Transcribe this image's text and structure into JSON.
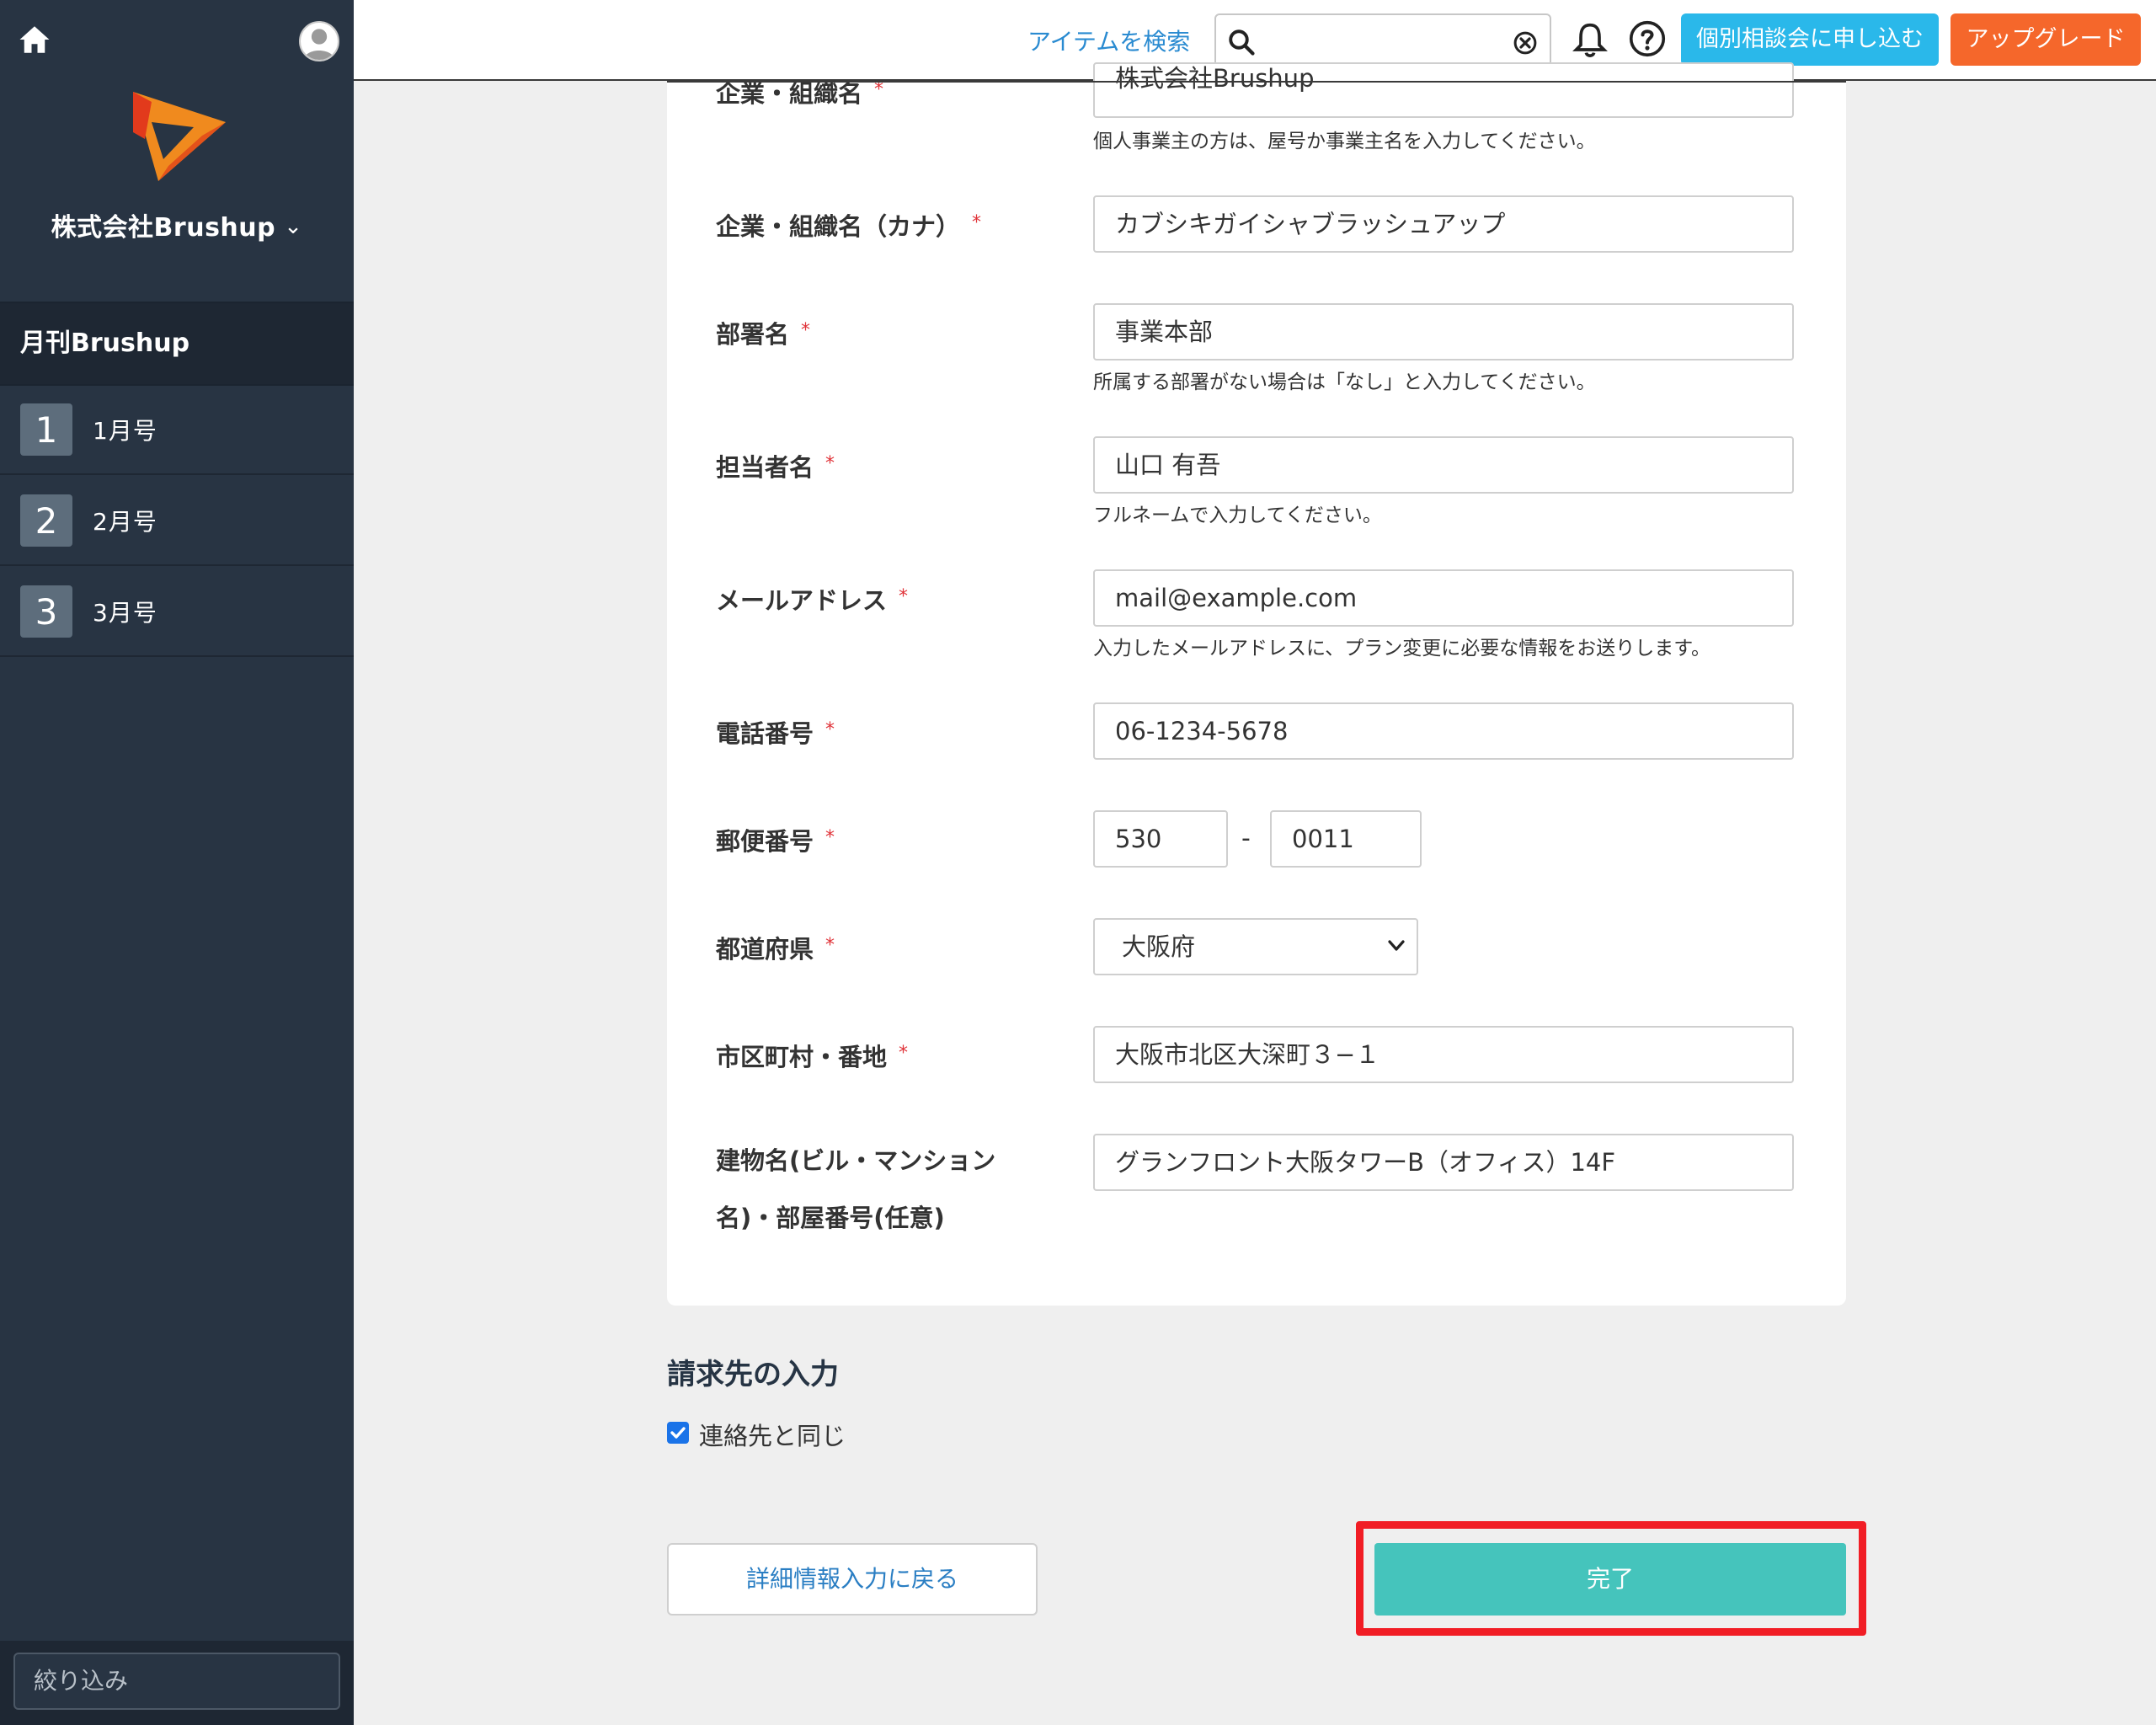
{
  "sidebar": {
    "org_name": "株式会社Brushup",
    "project_title": "月刊Brushup",
    "issues": [
      {
        "num": "1",
        "label": "1月号"
      },
      {
        "num": "2",
        "label": "2月号"
      },
      {
        "num": "3",
        "label": "3月号"
      }
    ],
    "filter_placeholder": "絞り込み"
  },
  "topbar": {
    "search_link": "アイテムを検索",
    "search_value": "",
    "consult_button": "個別相談会に申し込む",
    "upgrade_button": "アップグレード"
  },
  "form": {
    "company": {
      "label": "企業・組織名",
      "value": "株式会社Brushup",
      "help": "個人事業主の方は、屋号か事業主名を入力してください。"
    },
    "company_kana": {
      "label": "企業・組織名（カナ）",
      "value": "カブシキガイシャブラッシュアップ"
    },
    "department": {
      "label": "部署名",
      "value": "事業本部",
      "help": "所属する部署がない場合は「なし」と入力してください。"
    },
    "person": {
      "label": "担当者名",
      "value": "山口 有吾",
      "help": "フルネームで入力してください。"
    },
    "email": {
      "label": "メールアドレス",
      "value": "mail@example.com",
      "help": "入力したメールアドレスに、プラン変更に必要な情報をお送りします。"
    },
    "phone": {
      "label": "電話番号",
      "value": "06-1234-5678"
    },
    "zip": {
      "label": "郵便番号",
      "value1": "530",
      "value2": "0011",
      "dash": "-"
    },
    "prefecture": {
      "label": "都道府県",
      "value": "大阪府"
    },
    "city": {
      "label": "市区町村・番地",
      "value": "大阪市北区大深町３−１"
    },
    "building": {
      "label_line1": "建物名(ビル・マンション",
      "label_line2": "名)・部屋番号(任意)",
      "value": "グランフロント大阪タワーB（オフィス）14F"
    },
    "required_mark": "*"
  },
  "billing": {
    "title": "請求先の入力",
    "same_as_contact": "連絡先と同じ",
    "same_checked": true
  },
  "actions": {
    "back_button": "詳細情報入力に戻る",
    "done_button": "完了"
  },
  "colors": {
    "sidebar_bg": "#283443",
    "consult": "#2ab8ea",
    "upgrade": "#f5672b",
    "done": "#45c4bc",
    "highlight": "#f11d25",
    "required": "#e0343a"
  }
}
